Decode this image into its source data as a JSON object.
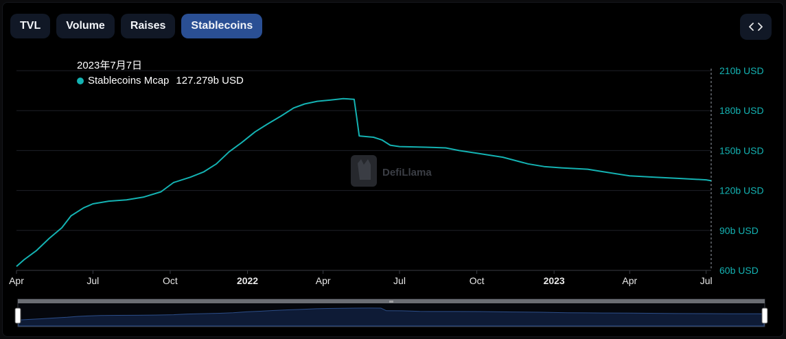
{
  "tabs": [
    {
      "label": "TVL",
      "active": false
    },
    {
      "label": "Volume",
      "active": false
    },
    {
      "label": "Raises",
      "active": false
    },
    {
      "label": "Stablecoins",
      "active": true
    }
  ],
  "tooltip": {
    "date": "2023年7月7日",
    "series_name": "Stablecoins Mcap",
    "value": "127.279b USD"
  },
  "watermark": "DefiLlama",
  "colors": {
    "line": "#14b3b3",
    "grid": "#1e2128",
    "axis_text": "#14b3b3",
    "slider_fill": "#0e1b36",
    "slider_line": "#2c4e8a"
  },
  "chart_data": {
    "type": "line",
    "title": "",
    "xlabel": "",
    "ylabel": "",
    "ylim": [
      60,
      210
    ],
    "xlim": [
      "2021-04-01",
      "2023-07-07"
    ],
    "grid": true,
    "y_ticks": [
      "60b USD",
      "90b USD",
      "120b USD",
      "150b USD",
      "180b USD",
      "210b USD"
    ],
    "x_ticks": [
      {
        "label": "Apr",
        "date": "2021-04-01",
        "bold": false
      },
      {
        "label": "Jul",
        "date": "2021-07-01",
        "bold": false
      },
      {
        "label": "Oct",
        "date": "2021-10-01",
        "bold": false
      },
      {
        "label": "2022",
        "date": "2022-01-01",
        "bold": true
      },
      {
        "label": "Apr",
        "date": "2022-04-01",
        "bold": false
      },
      {
        "label": "Jul",
        "date": "2022-07-01",
        "bold": false
      },
      {
        "label": "Oct",
        "date": "2022-10-01",
        "bold": false
      },
      {
        "label": "2023",
        "date": "2023-01-01",
        "bold": true
      },
      {
        "label": "Apr",
        "date": "2023-04-01",
        "bold": false
      },
      {
        "label": "Jul",
        "date": "2023-07-01",
        "bold": false
      }
    ],
    "series": [
      {
        "name": "Stablecoins Mcap",
        "points": [
          [
            "2021-04-01",
            63
          ],
          [
            "2021-04-10",
            68
          ],
          [
            "2021-04-25",
            75
          ],
          [
            "2021-05-10",
            84
          ],
          [
            "2021-05-25",
            92
          ],
          [
            "2021-06-05",
            101
          ],
          [
            "2021-06-20",
            107
          ],
          [
            "2021-07-01",
            110
          ],
          [
            "2021-07-20",
            112
          ],
          [
            "2021-08-10",
            113
          ],
          [
            "2021-08-30",
            115
          ],
          [
            "2021-09-20",
            119
          ],
          [
            "2021-10-05",
            126
          ],
          [
            "2021-10-25",
            130
          ],
          [
            "2021-11-10",
            134
          ],
          [
            "2021-11-25",
            140
          ],
          [
            "2021-12-10",
            149
          ],
          [
            "2021-12-25",
            156
          ],
          [
            "2022-01-10",
            164
          ],
          [
            "2022-01-25",
            170
          ],
          [
            "2022-02-10",
            176
          ],
          [
            "2022-02-25",
            182
          ],
          [
            "2022-03-10",
            185
          ],
          [
            "2022-03-25",
            187
          ],
          [
            "2022-04-10",
            188
          ],
          [
            "2022-04-25",
            189
          ],
          [
            "2022-05-08",
            188.5
          ],
          [
            "2022-05-11",
            175
          ],
          [
            "2022-05-14",
            161
          ],
          [
            "2022-05-31",
            160
          ],
          [
            "2022-06-10",
            158
          ],
          [
            "2022-06-20",
            154
          ],
          [
            "2022-07-01",
            153
          ],
          [
            "2022-08-01",
            152.5
          ],
          [
            "2022-08-25",
            152
          ],
          [
            "2022-09-10",
            150
          ],
          [
            "2022-10-01",
            148
          ],
          [
            "2022-11-01",
            145
          ],
          [
            "2022-12-01",
            140
          ],
          [
            "2022-12-20",
            138
          ],
          [
            "2023-01-10",
            137
          ],
          [
            "2023-02-10",
            136
          ],
          [
            "2023-03-01",
            134
          ],
          [
            "2023-04-01",
            131
          ],
          [
            "2023-05-01",
            130
          ],
          [
            "2023-06-01",
            129
          ],
          [
            "2023-07-01",
            128
          ],
          [
            "2023-07-07",
            127.3
          ]
        ]
      }
    ]
  }
}
